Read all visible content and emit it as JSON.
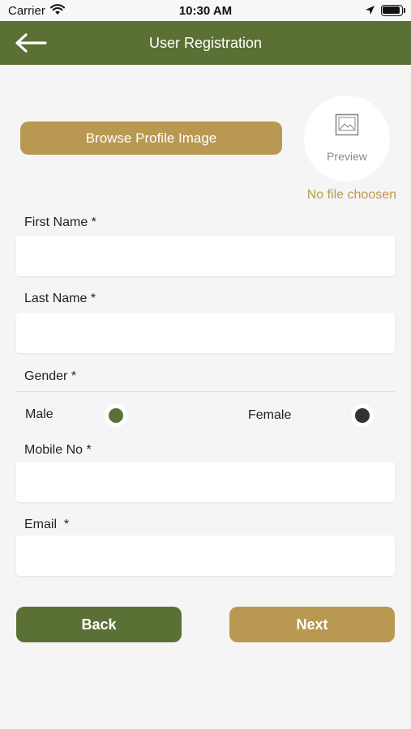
{
  "status_bar": {
    "carrier": "Carrier",
    "time": "10:30 AM"
  },
  "header": {
    "title": "User Registration",
    "back_icon": "arrow-left-icon"
  },
  "profile_image": {
    "browse_label": "Browse Profile Image",
    "preview_label": "Preview",
    "preview_icon": "image-icon",
    "file_status": "No file choosen"
  },
  "form": {
    "first_name_label": "First Name *",
    "last_name_label": "Last Name *",
    "gender_label": "Gender *",
    "gender_options": [
      {
        "label": "Male",
        "color": "#5b7034"
      },
      {
        "label": "Female",
        "color": "#333333"
      }
    ],
    "mobile_label": "Mobile No *",
    "email_label": "Email  *"
  },
  "buttons": {
    "back_label": "Back",
    "next_label": "Next"
  },
  "colors": {
    "primary_green": "#5b7034",
    "accent_gold": "#b99852",
    "background": "#f5f5f5"
  }
}
